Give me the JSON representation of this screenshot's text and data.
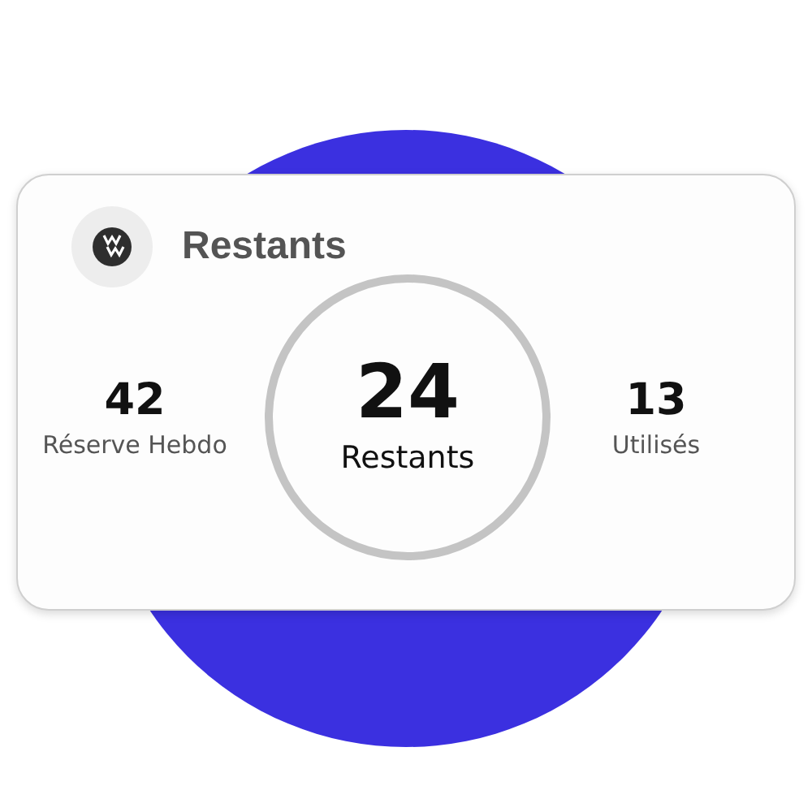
{
  "card": {
    "title": "Restants",
    "stats": [
      {
        "kind": "side",
        "value": "42",
        "label": "Réserve Hebdo"
      },
      {
        "kind": "main",
        "value": "24",
        "label": "Restants"
      },
      {
        "kind": "side",
        "value": "13",
        "label": "Utilisés"
      }
    ]
  }
}
